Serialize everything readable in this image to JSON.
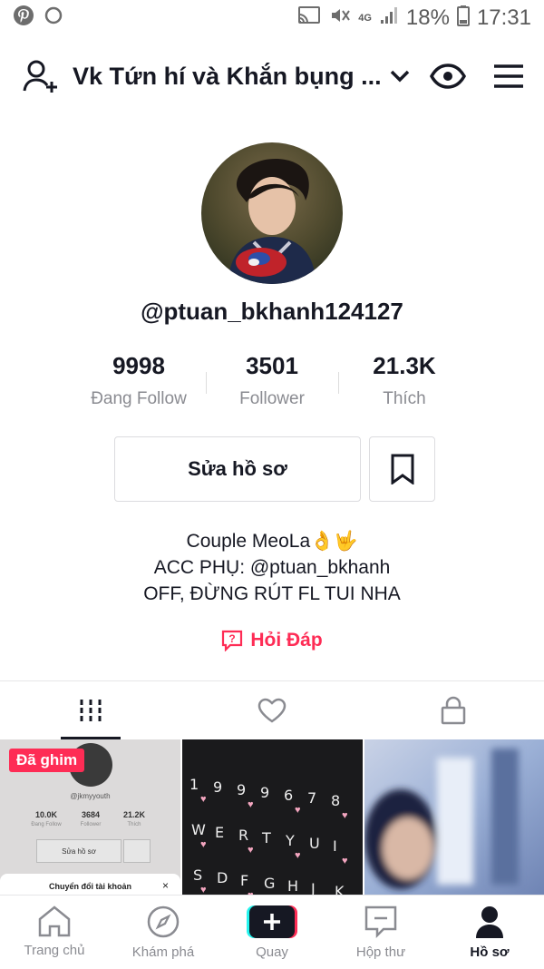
{
  "status_bar": {
    "battery": "18%",
    "time": "17:31",
    "network": "4G"
  },
  "header": {
    "title": "Vk Tứn hí và Khắn bụng ..."
  },
  "profile": {
    "username": "@ptuan_bkhanh124127",
    "stats": [
      {
        "value": "9998",
        "label": "Đang Follow"
      },
      {
        "value": "3501",
        "label": "Follower"
      },
      {
        "value": "21.3K",
        "label": "Thích"
      }
    ],
    "edit_label": "Sửa hồ sơ",
    "bio": [
      "Couple MeoLa👌🤟",
      "ACC PHỤ: @ptuan_bkhanh",
      "OFF, ĐỪNG RÚT FL TUI NHA"
    ],
    "qa_label": "Hỏi Đáp"
  },
  "videos": {
    "pinned_label": "Đã ghim",
    "thumb1": {
      "handle": "@jkmyyouth",
      "stats": [
        "10.0K",
        "3684",
        "21.2K"
      ],
      "stat_labels": [
        "Đang Follow",
        "Follower",
        "Thích"
      ],
      "edit": "Sửa hồ sơ",
      "sheet": "Chuyển đổi tài khoản"
    },
    "thumb2_keys": [
      "1",
      "9",
      "9",
      "9",
      "6",
      "7",
      "8",
      "W",
      "E",
      "R",
      "T",
      "Y",
      "U",
      "I",
      "S",
      "D",
      "F",
      "G",
      "H",
      "J",
      "K"
    ]
  },
  "nav": [
    {
      "label": "Trang chủ",
      "icon": "home-icon"
    },
    {
      "label": "Khám phá",
      "icon": "compass-icon"
    },
    {
      "label": "Quay",
      "icon": "plus-icon"
    },
    {
      "label": "Hộp thư",
      "icon": "inbox-icon"
    },
    {
      "label": "Hồ sơ",
      "icon": "profile-icon"
    }
  ],
  "colors": {
    "accent": "#fe2c55",
    "text": "#161823",
    "muted": "#8a8b91"
  }
}
